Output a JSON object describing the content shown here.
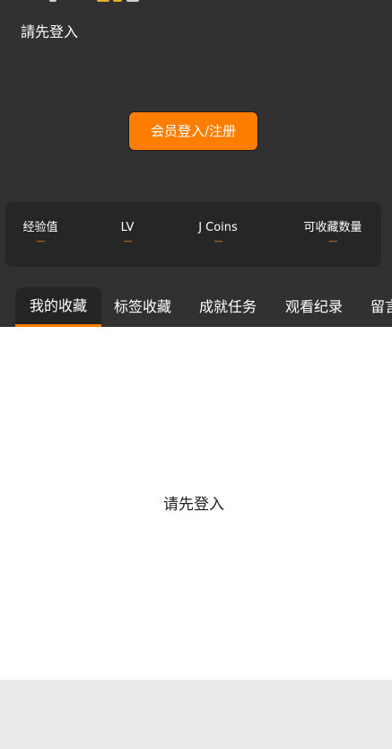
{
  "header": {
    "login_hint": "請先登入",
    "login_button": "会员登入/注册"
  },
  "stats": [
    {
      "label": "经验值",
      "value": "----"
    },
    {
      "label": "LV",
      "value": "----"
    },
    {
      "label": "J Coins",
      "value": "----"
    },
    {
      "label": "可收藏数量",
      "value": "----"
    }
  ],
  "tabs": [
    {
      "label": "我的收藏",
      "active": true
    },
    {
      "label": "标签收藏"
    },
    {
      "label": "成就任务"
    },
    {
      "label": "观看纪录"
    },
    {
      "label": "留言"
    }
  ],
  "content": {
    "empty_message": "请先登入"
  },
  "colors": {
    "accent": "#ff7e00",
    "header_bg": "#313131",
    "card_bg": "#262626",
    "content_bg": "#ffffff",
    "footer_bg": "#ebebeb"
  }
}
